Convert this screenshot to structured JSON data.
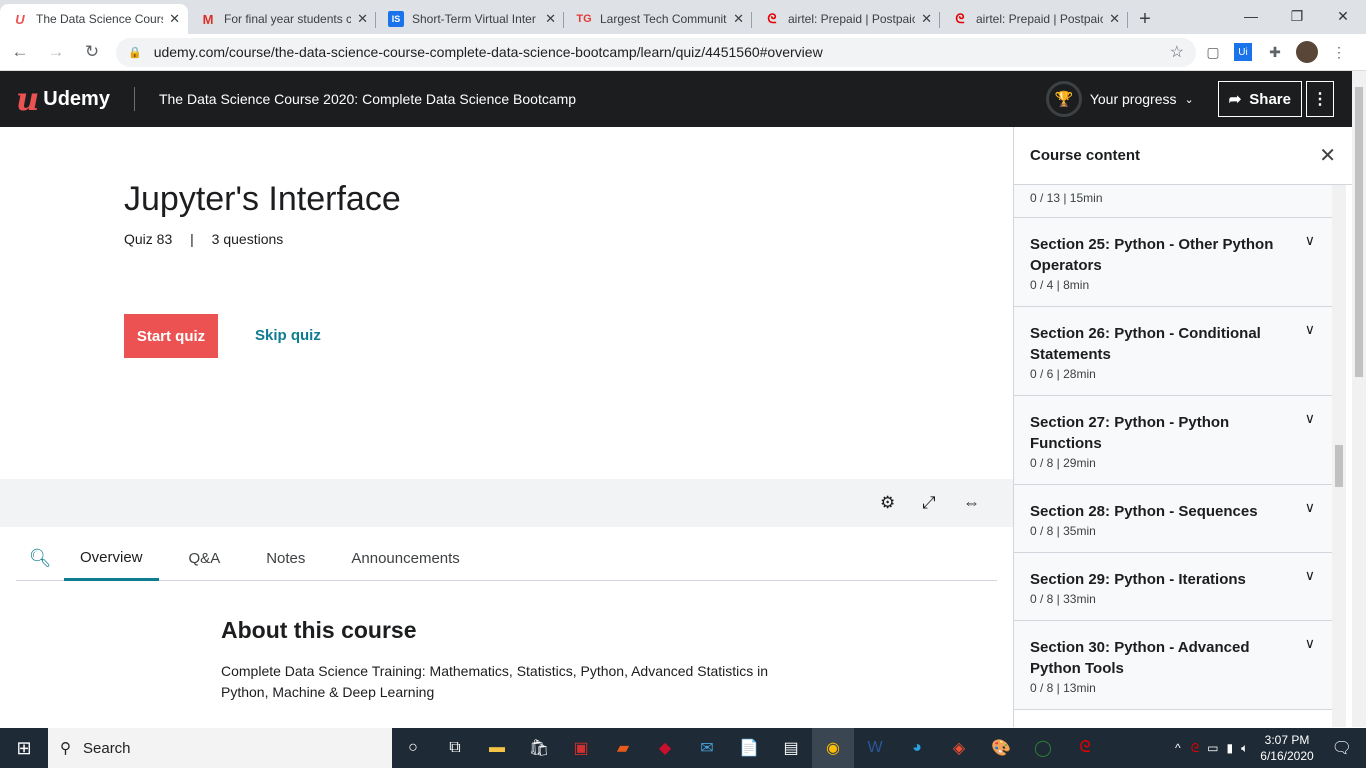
{
  "browser": {
    "tabs": [
      {
        "title": "The Data Science Cours",
        "icon": "udemy-favicon",
        "color": "#ec5252",
        "glyph": "U"
      },
      {
        "title": "For final year students c",
        "icon": "gmail-favicon",
        "color": "#d93025",
        "glyph": "M"
      },
      {
        "title": "Short-Term Virtual Inter",
        "icon": "is-favicon",
        "color": "#1a73e8",
        "glyph": "IS"
      },
      {
        "title": "Largest Tech Communit",
        "icon": "tg-favicon",
        "color": "#e53935",
        "glyph": "TG"
      },
      {
        "title": "airtel: Prepaid | Postpaic",
        "icon": "airtel-favicon",
        "color": "#e40000",
        "glyph": "a"
      },
      {
        "title": "airtel: Prepaid | Postpaic",
        "icon": "airtel-favicon",
        "color": "#e40000",
        "glyph": "a"
      }
    ],
    "url": "udemy.com/course/the-data-science-course-complete-data-science-bootcamp/learn/quiz/4451560#overview"
  },
  "header": {
    "brand": "Udemy",
    "course_title": "The Data Science Course 2020: Complete Data Science Bootcamp",
    "progress_label": "Your progress",
    "share_label": "Share"
  },
  "quiz": {
    "title": "Jupyter's Interface",
    "number": "Quiz 83",
    "separator": "|",
    "questions": "3 questions",
    "start_label": "Start quiz",
    "skip_label": "Skip quiz"
  },
  "tabs": [
    {
      "label": "Overview"
    },
    {
      "label": "Q&A"
    },
    {
      "label": "Notes"
    },
    {
      "label": "Announcements"
    }
  ],
  "about": {
    "heading": "About this course",
    "description": "Complete Data Science Training: Mathematics, Statistics, Python, Advanced Statistics in Python, Machine & Deep Learning"
  },
  "sidebar": {
    "title": "Course content",
    "first_meta": "0 / 13 | 15min",
    "sections": [
      {
        "title": "Section 25: Python - Other Python Operators",
        "meta": "0 / 4 | 8min"
      },
      {
        "title": "Section 26: Python - Conditional Statements",
        "meta": "0 / 6 | 28min"
      },
      {
        "title": "Section 27: Python - Python Functions",
        "meta": "0 / 8 | 29min"
      },
      {
        "title": "Section 28: Python - Sequences",
        "meta": "0 / 8 | 35min"
      },
      {
        "title": "Section 29: Python - Iterations",
        "meta": "0 / 8 | 33min"
      },
      {
        "title": "Section 30: Python - Advanced Python Tools",
        "meta": "0 / 8 | 13min"
      }
    ]
  },
  "taskbar": {
    "search_placeholder": "Search",
    "time": "3:07 PM",
    "date": "6/16/2020"
  }
}
